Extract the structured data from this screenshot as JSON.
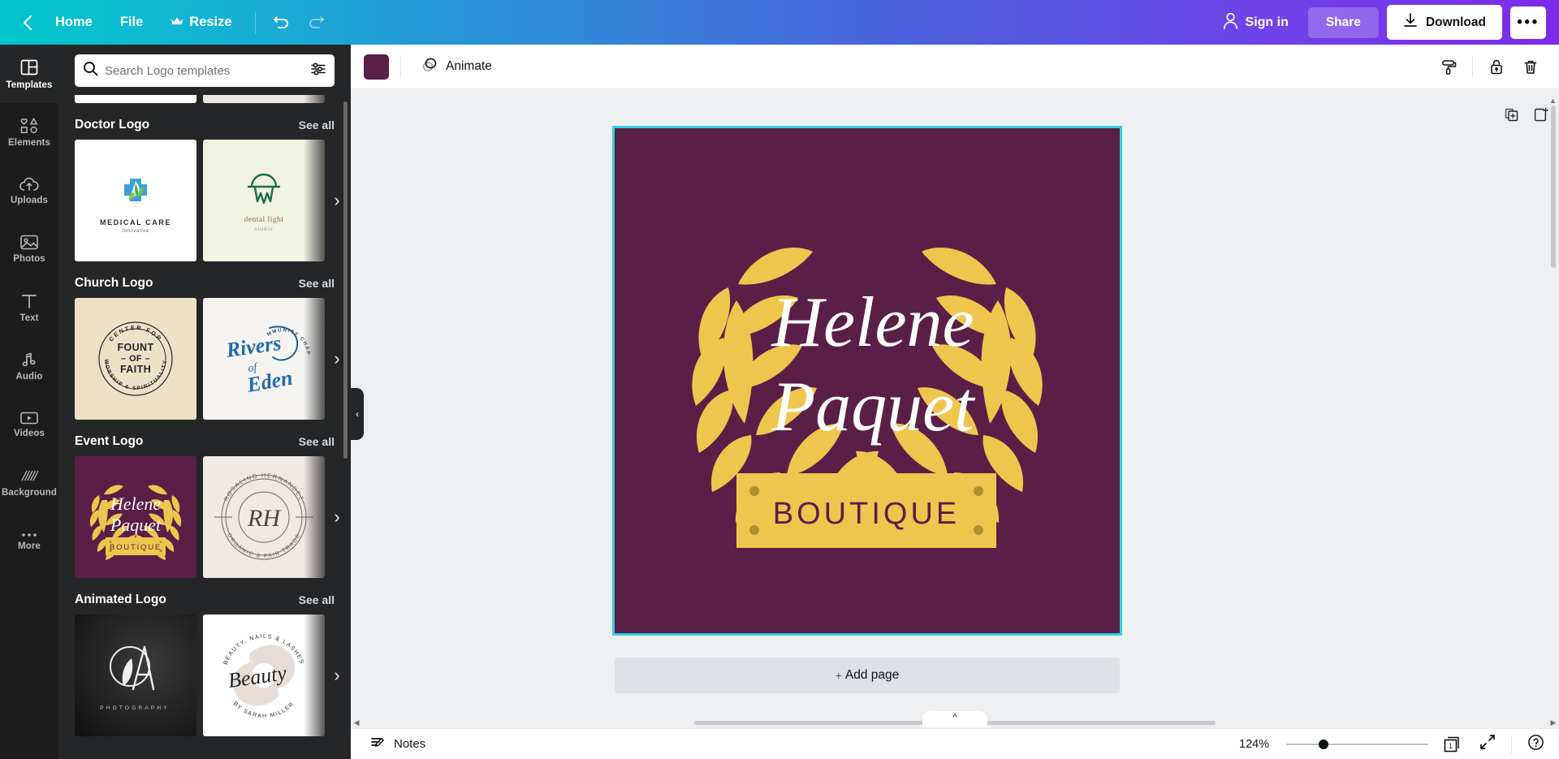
{
  "topbar": {
    "back_icon": "chevron-left-icon",
    "home": "Home",
    "file": "File",
    "resize": "Resize",
    "resize_icon": "crown-icon",
    "undo_icon": "undo-icon",
    "redo_icon": "redo-icon",
    "signin": "Sign in",
    "signin_icon": "user-icon",
    "share": "Share",
    "download": "Download",
    "download_icon": "download-icon",
    "more": "•••",
    "gradient_from": "#00c4cc",
    "gradient_to": "#7d2ae8"
  },
  "rail": {
    "items": [
      {
        "label": "Templates",
        "icon": "templates-icon",
        "active": true
      },
      {
        "label": "Elements",
        "icon": "elements-icon",
        "active": false
      },
      {
        "label": "Uploads",
        "icon": "uploads-cloud-icon",
        "active": false
      },
      {
        "label": "Photos",
        "icon": "photos-image-icon",
        "active": false
      },
      {
        "label": "Text",
        "icon": "text-t-icon",
        "active": false
      },
      {
        "label": "Audio",
        "icon": "audio-note-icon",
        "active": false
      },
      {
        "label": "Videos",
        "icon": "videos-play-icon",
        "active": false
      },
      {
        "label": "Background",
        "icon": "background-hatch-icon",
        "active": false
      },
      {
        "label": "More",
        "icon": "more-dots-icon",
        "active": false
      }
    ]
  },
  "panel": {
    "search": {
      "placeholder": "Search Logo templates",
      "value": "",
      "search_icon": "search-icon",
      "filter_icon": "filter-sliders-icon"
    },
    "see_all_label": "See all",
    "arrow_icon": "chevron-right-icon",
    "sections": [
      {
        "title": "Doctor Logo",
        "templates": [
          {
            "name": "MEDICAL CARE",
            "subtitle": "Innovative",
            "bg": "#ffffff"
          },
          {
            "name": "dental light",
            "subtitle": "studio",
            "bg": "#f0f2e2"
          }
        ]
      },
      {
        "title": "Church Logo",
        "templates": [
          {
            "name": "FOUNT OF FAITH",
            "top_text": "CENTER FOR",
            "bottom_text": "WORSHIP & SPIRITUALITY",
            "bg": "#ece3c6"
          },
          {
            "name": "Rivers of Eden",
            "top_text": "COMMUNITY CHAPEL",
            "bg": "#f5f4f1"
          }
        ]
      },
      {
        "title": "Event Logo",
        "templates": [
          {
            "name": "Helene Paquet",
            "sub": "BOUTIQUE",
            "bg": "#5a1f47"
          },
          {
            "name": "RH",
            "top_text": "ROSALIND HERNANDEZ",
            "bottom_text": "ORGANIC & FAIR TRADE",
            "bg": "#f1e9e6"
          }
        ]
      },
      {
        "title": "Animated Logo",
        "templates": [
          {
            "name": "A",
            "sub": "PHOTOGRAPHY",
            "bg": "#2b2b2b"
          },
          {
            "name": "Beauty",
            "top_text": "BEAUTY, NAILS & LASHES BY SARAH MILLER",
            "bg": "#ffffff"
          }
        ]
      }
    ],
    "collapse_icon": "chevron-left-icon"
  },
  "editor_toolbar": {
    "color_swatch": "#5a1f47",
    "animate_label": "Animate",
    "animate_icon": "animate-circles-icon",
    "right_icons": [
      {
        "name": "paint-roller-icon"
      },
      {
        "name": "lock-icon"
      },
      {
        "name": "trash-icon"
      }
    ]
  },
  "canvas": {
    "page_tools": [
      {
        "name": "duplicate-page-icon"
      },
      {
        "name": "add-page-icon"
      }
    ],
    "add_page_label": "Add page",
    "add_page_plus": "+",
    "collapse_tab_icon": "chevron-up-icon",
    "design": {
      "background": "#5a1f47",
      "accent": "#efc64d",
      "line1": "Helene",
      "line2": "Paquet",
      "banner_text": "BOUTIQUE",
      "banner_color": "#efc64d",
      "banner_text_color": "#5a1f47",
      "selection_color": "#2fd1e0"
    }
  },
  "bottombar": {
    "notes_label": "Notes",
    "notes_icon": "notes-pencil-icon",
    "zoom_value": "124%",
    "page_number": "1",
    "page_count_icon": "pages-icon",
    "fullscreen_icon": "expand-arrows-icon",
    "help_icon": "help-question-icon"
  }
}
